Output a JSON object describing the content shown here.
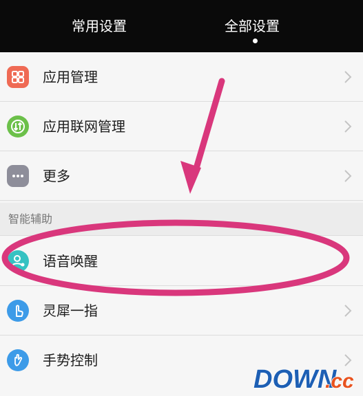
{
  "header": {
    "tabs": [
      {
        "label": "常用设置",
        "selected": false
      },
      {
        "label": "全部设置",
        "selected": true
      }
    ]
  },
  "rows": [
    {
      "label": "应用管理",
      "icon": "app-management-icon",
      "color": "#ef6a54"
    },
    {
      "label": "应用联网管理",
      "icon": "network-management-icon",
      "color": "#6cc04a"
    },
    {
      "label": "更多",
      "icon": "more-icon",
      "color": "#8e8e9a"
    }
  ],
  "section": {
    "title": "智能辅助"
  },
  "assist_rows": [
    {
      "label": "语音唤醒",
      "icon": "voice-wake-icon",
      "color": "#36c2c2"
    },
    {
      "label": "灵犀一指",
      "icon": "finger-gesture-icon",
      "color": "#3d9be8"
    },
    {
      "label": "手势控制",
      "icon": "hand-gesture-icon",
      "color": "#3d9be8"
    }
  ],
  "annotation": {
    "color": "#d9377c"
  },
  "watermark": {
    "brand": "DOWN",
    "suffix": ".cc",
    "brand_color": "#1d5fb4",
    "suffix_color": "#e8531f"
  }
}
